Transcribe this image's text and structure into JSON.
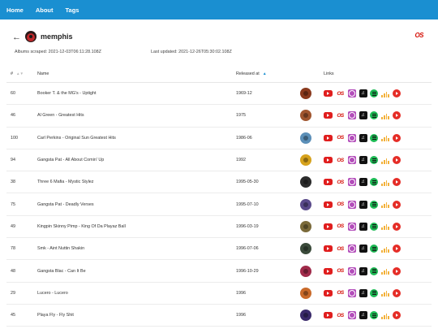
{
  "nav": {
    "items": [
      "Home",
      "About",
      "Tags"
    ]
  },
  "header": {
    "title": "memphis",
    "albums_scraped": "Albums scraped:  2021-12-03T06:11:28.108Z",
    "last_updated": "Last updated:  2021-12-26T05:30:02.108Z",
    "lastfm_logo": "OS"
  },
  "table": {
    "columns": {
      "num": "#",
      "name": "Name",
      "released": "Released at",
      "links": "Links"
    },
    "rows": [
      {
        "num": "60",
        "name": "Booker T. & the MG's - Uptight",
        "released": "1969-12",
        "thumb_color": "#8a3a1e"
      },
      {
        "num": "46",
        "name": "Al Green - Greatest Hits",
        "released": "1975",
        "thumb_color": "#a0552e"
      },
      {
        "num": "100",
        "name": "Carl Perkins - Original Sun Greatest Hits",
        "released": "1986-06",
        "thumb_color": "#5b8fb8"
      },
      {
        "num": "94",
        "name": "Gangsta Pat - All About Comin' Up",
        "released": "1992",
        "thumb_color": "#d6a21c"
      },
      {
        "num": "38",
        "name": "Three 6 Mafia - Mystic Stylez",
        "released": "1995-05-30",
        "thumb_color": "#2b2b2b"
      },
      {
        "num": "75",
        "name": "Gangsta Pat - Deadly Verses",
        "released": "1995-07-10",
        "thumb_color": "#5a4a8a"
      },
      {
        "num": "49",
        "name": "Kingpin Skinny Pimp - King Of Da Playaz Ball",
        "released": "1996-03-19",
        "thumb_color": "#7a6a3a"
      },
      {
        "num": "78",
        "name": "Smk - Aint Nuttin Shakin",
        "released": "1996-07-06",
        "thumb_color": "#3a4a3a"
      },
      {
        "num": "48",
        "name": "Gangsta Blac - Can It Be",
        "released": "1996-10-29",
        "thumb_color": "#a02a4a"
      },
      {
        "num": "29",
        "name": "Lucero - Lucero",
        "released": "1996",
        "thumb_color": "#c96a2a"
      },
      {
        "num": "45",
        "name": "Playa Fly - Fly Shit",
        "released": "1996",
        "thumb_color": "#3a2a6a"
      }
    ]
  },
  "link_icons": {
    "youtube": "youtube-icon",
    "lastfm": "OS",
    "discogs": "discogs-icon",
    "apple": "♫",
    "spotify": "spotify-icon",
    "deezer": "deezer-icon",
    "play": "youtube-music-icon"
  },
  "colors": {
    "topbar": "#1a8fd1",
    "lastfm_red": "#d51007",
    "sort_active": "#1a8fd1"
  }
}
